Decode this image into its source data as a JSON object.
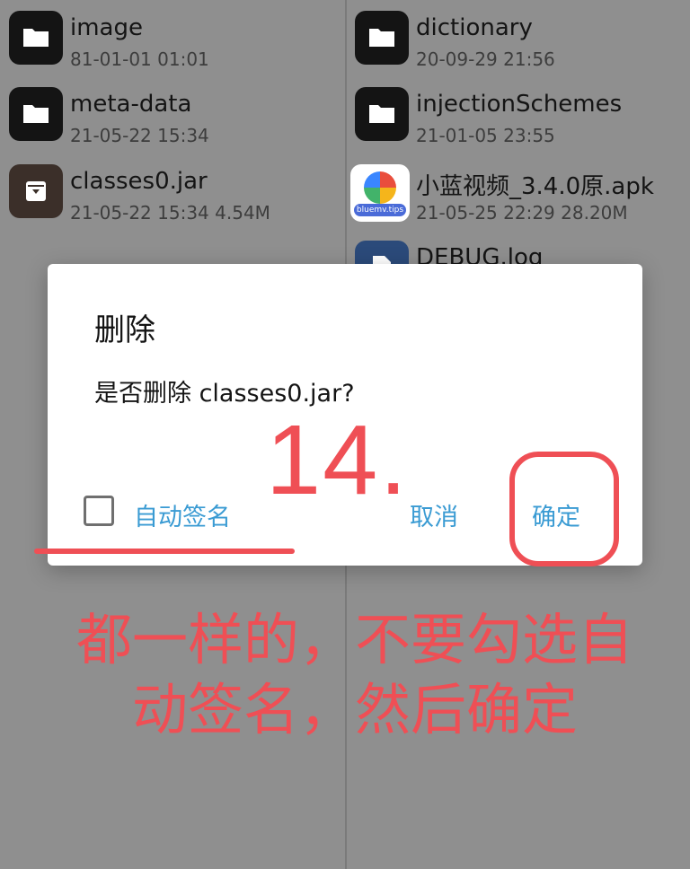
{
  "files_left": [
    {
      "name": "image",
      "meta": "81-01-01 01:01",
      "icon": "folder-icon"
    },
    {
      "name": "meta-data",
      "meta": "21-05-22 15:34",
      "icon": "folder-icon"
    },
    {
      "name": "classes0.jar",
      "meta": "21-05-22 15:34  4.54M",
      "icon": "archive-icon"
    }
  ],
  "files_right": [
    {
      "name": "dictionary",
      "meta": "20-09-29 21:56",
      "icon": "folder-icon"
    },
    {
      "name": "injectionSchemes",
      "meta": "21-01-05 23:55",
      "icon": "folder-icon"
    },
    {
      "name": "小蓝视频_3.4.0原.apk",
      "meta": "21-05-25 22:29  28.20M",
      "icon": "app-icon",
      "badge": "bluemv.tips"
    },
    {
      "name": "DEBUG.log",
      "meta": "",
      "icon": "file-icon"
    }
  ],
  "dialog": {
    "title": "删除",
    "message": "是否删除 classes0.jar?",
    "checkbox_label": "自动签名",
    "checkbox_checked": false,
    "cancel_label": "取消",
    "confirm_label": "确定"
  },
  "annotation": {
    "step_number": "14.",
    "line1": "都一样的，不要勾选自",
    "line2": "动签名，然后确定",
    "color": "#ef4f55"
  }
}
